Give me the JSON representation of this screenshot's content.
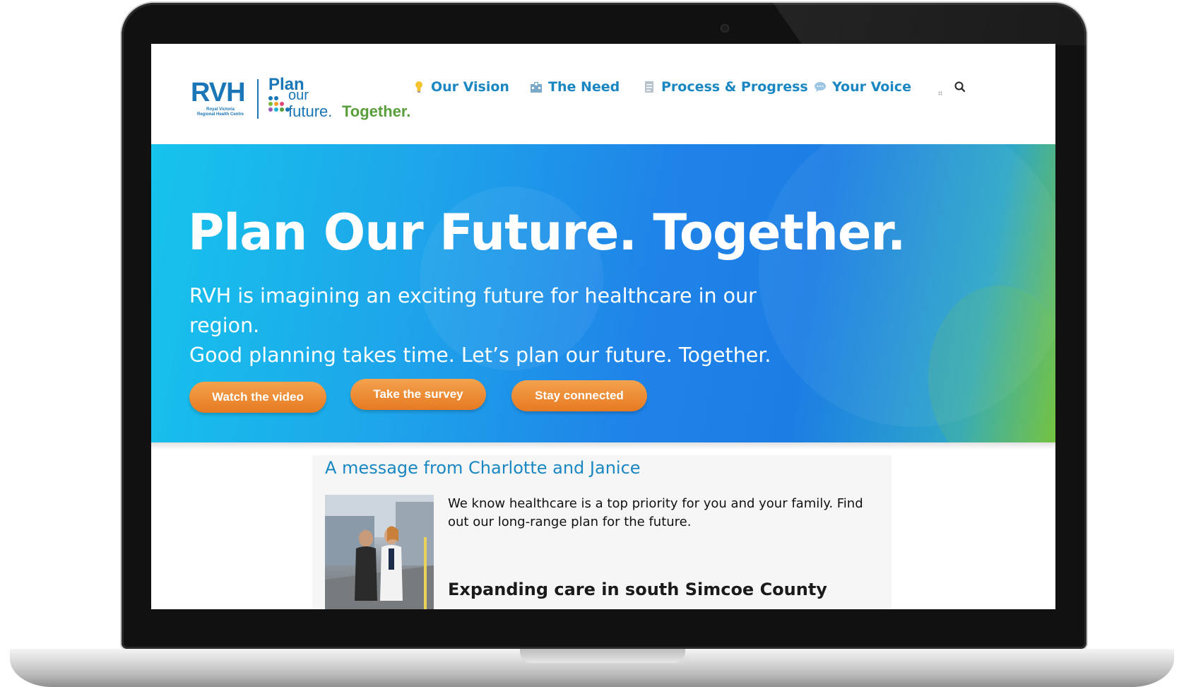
{
  "logo": {
    "rvh": "RVH",
    "rvh_sub_1": "Royal Victoria",
    "rvh_sub_2": "Regional Health Centre",
    "plan": "Plan",
    "our": "our",
    "future": "future.",
    "together": "Together."
  },
  "nav": {
    "items": [
      {
        "label": "Our Vision",
        "icon": "lightbulb-icon"
      },
      {
        "label": "The Need",
        "icon": "hospital-icon"
      },
      {
        "label": "Process & Progress",
        "icon": "document-icon"
      },
      {
        "label": "Your Voice",
        "icon": "speech-bubble-icon"
      }
    ],
    "search_icon": "search-icon"
  },
  "hero": {
    "title": "Plan Our Future. Together.",
    "subtitle_line1": "RVH is imagining an exciting future for healthcare in our region.",
    "subtitle_line2": "Good planning takes time. Let’s plan our future. Together.",
    "buttons": [
      {
        "label": "Watch the video"
      },
      {
        "label": "Take the survey"
      },
      {
        "label": "Stay connected"
      }
    ]
  },
  "message": {
    "title": "A message from Charlotte and Janice",
    "body": "We know healthcare is a top priority for you and your family. Find out our long-range plan for the future.",
    "subheading": "Expanding care in south Simcoe County"
  },
  "colors": {
    "brand_blue": "#1a87c2",
    "brand_green": "#5a9e3c",
    "button_orange": "#e67a22"
  }
}
